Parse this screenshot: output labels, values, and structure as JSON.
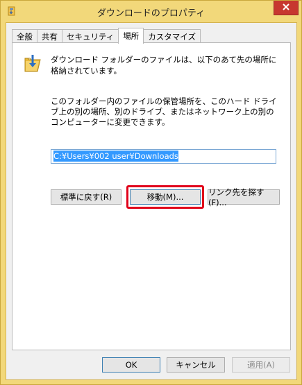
{
  "window": {
    "title": "ダウンロードのプロパティ"
  },
  "tabs": [
    {
      "label": "全般"
    },
    {
      "label": "共有"
    },
    {
      "label": "セキュリティ"
    },
    {
      "label": "場所",
      "active": true
    },
    {
      "label": "カスタマイズ"
    }
  ],
  "location": {
    "description1": "ダウンロード フォルダーのファイルは、以下のあて先の場所に格納されています。",
    "description2": "このフォルダー内のファイルの保管場所を、このハード ドライブ上の別の場所、別のドライブ、またはネットワーク上の別のコンピューターに変更できます。",
    "path_value": "C:¥Users¥002 user¥Downloads",
    "restore_label": "標準に戻す(R)",
    "move_label": "移動(M)...",
    "find_target_label": "リンク先を探す(F)..."
  },
  "footer": {
    "ok_label": "OK",
    "cancel_label": "キャンセル",
    "apply_label": "適用(A)"
  },
  "colors": {
    "titlebar": "#f2d87a",
    "close_button": "#c7372f",
    "highlight": "#e0001a",
    "selection": "#3399ff"
  },
  "icons": {
    "title": "folder-download-icon",
    "close": "close-icon",
    "folder": "downloads-folder-icon"
  }
}
